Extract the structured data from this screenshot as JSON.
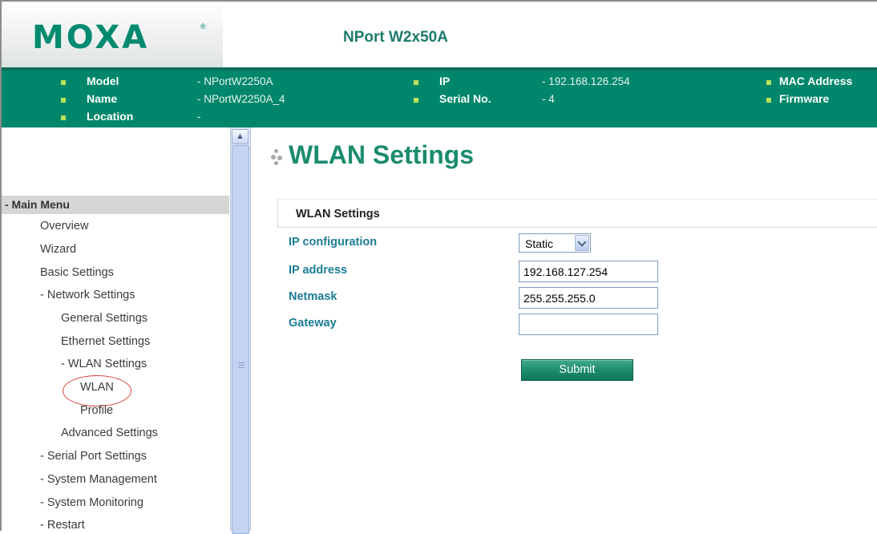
{
  "header": {
    "logo_text": "MOXA",
    "logo_reg": "®",
    "product_name": "NPort W2x50A"
  },
  "info": {
    "model_label": "Model",
    "model_value": "- NPortW2250A",
    "name_label": "Name",
    "name_value": "- NPortW2250A_4",
    "location_label": "Location",
    "location_value": "-",
    "ip_label": "IP",
    "ip_value": "- 192.168.126.254",
    "serial_label": "Serial No.",
    "serial_value": "- 4",
    "mac_label": "MAC Address",
    "firmware_label": "Firmware"
  },
  "sidebar": {
    "main_menu": "- Main Menu",
    "items": [
      "Overview",
      "Wizard",
      "Basic Settings",
      "- Network Settings",
      "General Settings",
      "Ethernet Settings",
      "- WLAN Settings",
      "WLAN",
      "Profile",
      "Advanced Settings",
      "- Serial Port Settings",
      "- System Management",
      "- System Monitoring",
      "- Restart"
    ]
  },
  "content": {
    "page_title": "WLAN Settings",
    "section_title": "WLAN Settings",
    "ip_config_label": "IP configuration",
    "ip_config_value": "Static",
    "ip_address_label": "IP address",
    "ip_address_value": "192.168.127.254",
    "netmask_label": "Netmask",
    "netmask_value": "255.255.255.0",
    "gateway_label": "Gateway",
    "gateway_value": "",
    "submit_label": "Submit"
  },
  "colors": {
    "brand_green": "#00876b",
    "title_green": "#1b8c6d",
    "label_blue": "#1b7c95",
    "highlight_circle": "#d9413b"
  }
}
